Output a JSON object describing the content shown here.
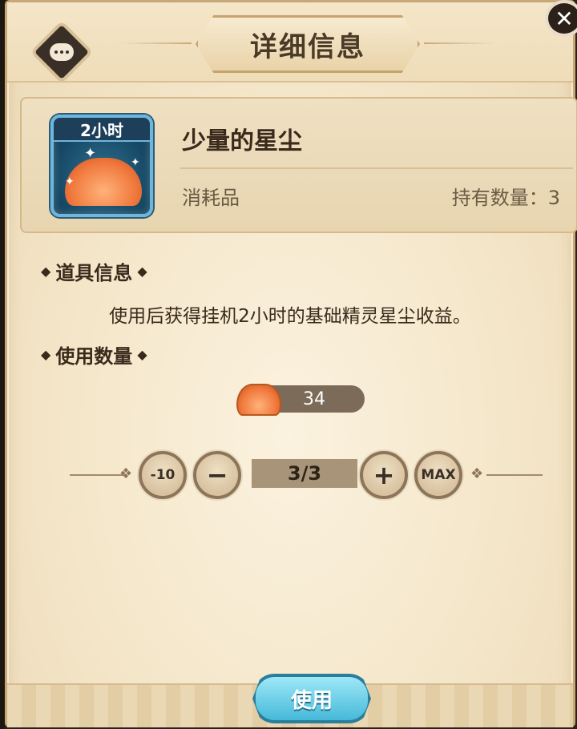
{
  "header": {
    "title": "详细信息",
    "close_icon": "close-icon",
    "menu_icon": "chat-bubble-icon"
  },
  "item": {
    "name": "少量的星尘",
    "icon_tag": "2小时",
    "type": "消耗品",
    "owned_label": "持有数量：3"
  },
  "sections": {
    "info_title": "道具信息",
    "info_desc": "使用后获得挂机2小时的基础精灵星尘收益。",
    "qty_title": "使用数量"
  },
  "stock": {
    "value": "34"
  },
  "quantity": {
    "minus10_label": "-10",
    "minus_label": "−",
    "display": "3/3",
    "plus_label": "+",
    "max_label": "MAX"
  },
  "actions": {
    "use_label": "使用"
  },
  "colors": {
    "panel_bg": "#f4e6c9",
    "accent_blue": "#46b9d9",
    "text_dark": "#3a2a1c"
  }
}
